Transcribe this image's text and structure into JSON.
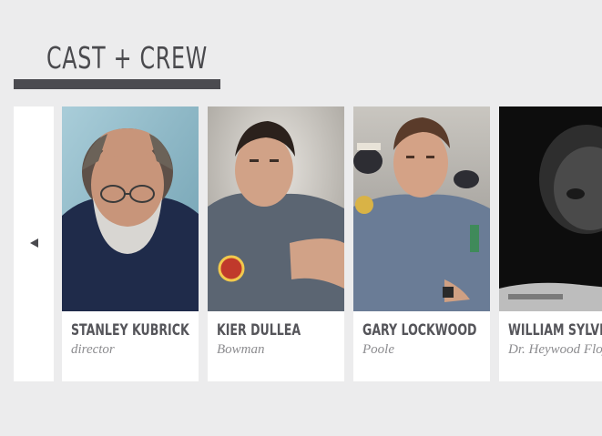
{
  "section": {
    "title": "CAST + CREW"
  },
  "nav": {
    "prev_icon": "triangle-left-icon"
  },
  "cast": [
    {
      "name": "STANLEY KUBRICK",
      "role": "director"
    },
    {
      "name": "KIER DULLEA",
      "role": "Bowman"
    },
    {
      "name": "GARY LOCKWOOD",
      "role": "Poole"
    },
    {
      "name": "WILLIAM SYLVESTER",
      "role": "Dr. Heywood Floyd"
    }
  ],
  "colors": {
    "background": "#ececed",
    "title": "#4a4a4e",
    "card": "#ffffff",
    "role_text": "#8c8c8f"
  }
}
